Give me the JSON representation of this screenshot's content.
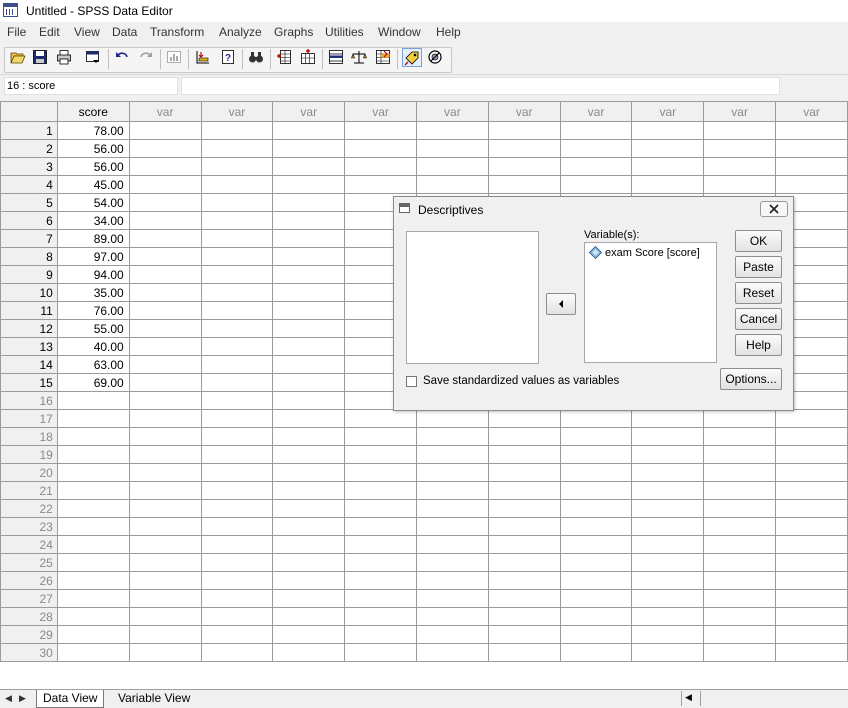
{
  "window": {
    "title": "Untitled - SPSS Data Editor"
  },
  "menu": [
    "File",
    "Edit",
    "View",
    "Data",
    "Transform",
    "Analyze",
    "Graphs",
    "Utilities",
    "Window",
    "Help"
  ],
  "toolbar": {
    "icons": [
      "open-icon",
      "save-icon",
      "print-icon",
      "dialog-recall-icon",
      "undo-icon",
      "redo-icon",
      "chart-icon",
      "goto-case-icon",
      "variables-icon",
      "find-icon",
      "insert-case-icon",
      "insert-variable-icon",
      "split-file-icon",
      "weight-cases-icon",
      "select-cases-icon",
      "value-labels-icon",
      "use-sets-icon"
    ]
  },
  "cell_editor": {
    "reference": "16 : score",
    "value": ""
  },
  "grid": {
    "columns": [
      "score",
      "var",
      "var",
      "var",
      "var",
      "var",
      "var",
      "var",
      "var",
      "var",
      "var"
    ],
    "rows": [
      {
        "n": "1",
        "score": "78.00"
      },
      {
        "n": "2",
        "score": "56.00"
      },
      {
        "n": "3",
        "score": "56.00"
      },
      {
        "n": "4",
        "score": "45.00"
      },
      {
        "n": "5",
        "score": "54.00"
      },
      {
        "n": "6",
        "score": "34.00"
      },
      {
        "n": "7",
        "score": "89.00"
      },
      {
        "n": "8",
        "score": "97.00"
      },
      {
        "n": "9",
        "score": "94.00"
      },
      {
        "n": "10",
        "score": "35.00"
      },
      {
        "n": "11",
        "score": "76.00"
      },
      {
        "n": "12",
        "score": "55.00"
      },
      {
        "n": "13",
        "score": "40.00"
      },
      {
        "n": "14",
        "score": "63.00"
      },
      {
        "n": "15",
        "score": "69.00"
      },
      {
        "n": "16",
        "score": ""
      },
      {
        "n": "17",
        "score": ""
      },
      {
        "n": "18",
        "score": ""
      },
      {
        "n": "19",
        "score": ""
      },
      {
        "n": "20",
        "score": ""
      },
      {
        "n": "21",
        "score": ""
      },
      {
        "n": "22",
        "score": ""
      },
      {
        "n": "23",
        "score": ""
      },
      {
        "n": "24",
        "score": ""
      },
      {
        "n": "25",
        "score": ""
      },
      {
        "n": "26",
        "score": ""
      },
      {
        "n": "27",
        "score": ""
      },
      {
        "n": "28",
        "score": ""
      },
      {
        "n": "29",
        "score": ""
      },
      {
        "n": "30",
        "score": ""
      }
    ]
  },
  "tabs": {
    "data_view": "Data View",
    "variable_view": "Variable View"
  },
  "dialog": {
    "title": "Descriptives",
    "variables_label": "Variable(s):",
    "selected_variable": "exam Score [score]",
    "checkbox_label": "Save standardized values as variables",
    "buttons": {
      "ok": "OK",
      "paste": "Paste",
      "reset": "Reset",
      "cancel": "Cancel",
      "help": "Help",
      "options": "Options..."
    }
  }
}
